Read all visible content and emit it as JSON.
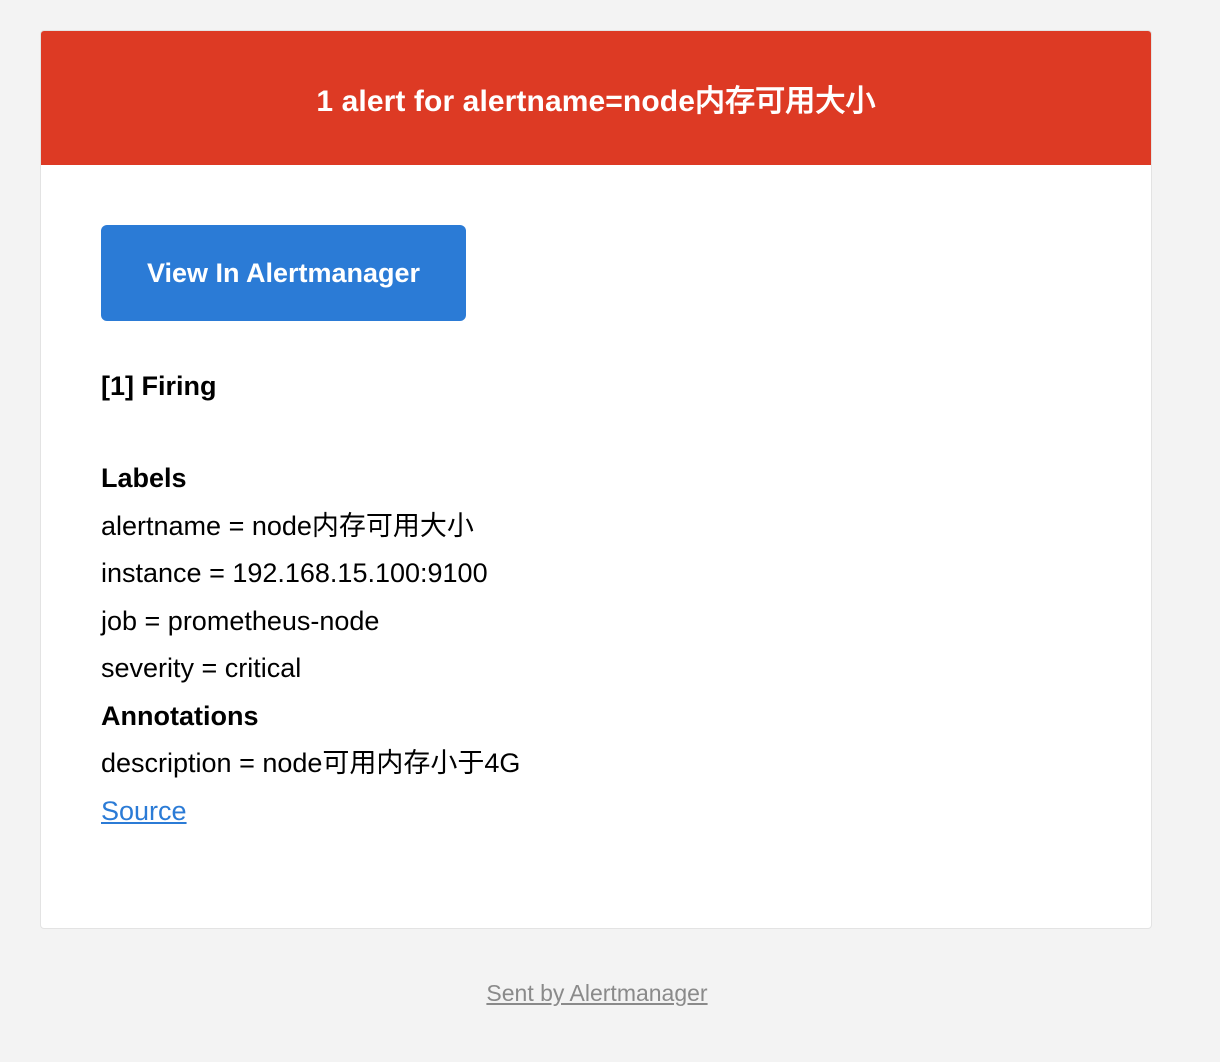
{
  "header": {
    "title": "1 alert for alertname=node内存可用大小",
    "background_color": "#dd3a24"
  },
  "actions": {
    "view_button_label": "View In Alertmanager",
    "button_color": "#2b7bd6"
  },
  "alert_group": {
    "heading": "[1] Firing"
  },
  "labels": {
    "heading": "Labels",
    "items": [
      "alertname = node内存可用大小",
      "instance = 192.168.15.100:9100",
      "job = prometheus-node",
      "severity = critical"
    ]
  },
  "annotations": {
    "heading": "Annotations",
    "items": [
      "description = node可用内存小于4G"
    ]
  },
  "source_link": "Source",
  "footer": {
    "text": "Sent by Alertmanager"
  }
}
